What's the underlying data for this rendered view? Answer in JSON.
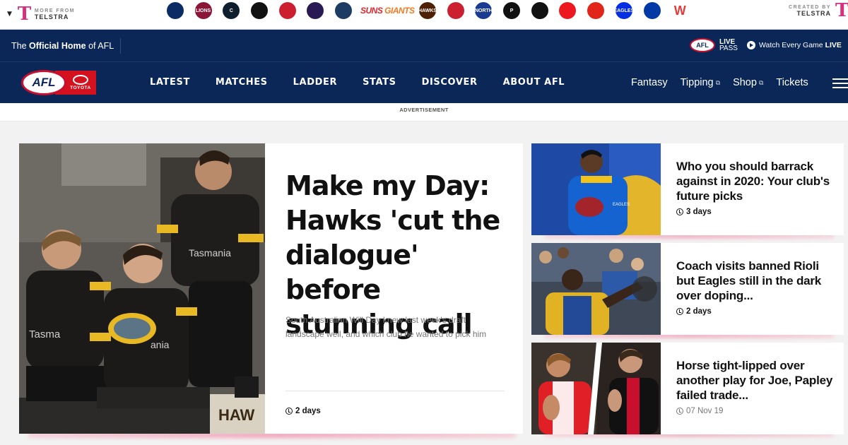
{
  "topbar": {
    "left_small": "MORE FROM",
    "left_brand": "TELSTRA",
    "right_small": "CREATED BY",
    "right_brand": "TELSTRA",
    "clubs": [
      {
        "name": "adelaide-crows",
        "color": "#0a2b64",
        "text": ""
      },
      {
        "name": "brisbane-lions",
        "color": "#8a1538",
        "text": "LIONS"
      },
      {
        "name": "carlton",
        "color": "#0e1e2d",
        "text": "C"
      },
      {
        "name": "collingwood",
        "color": "#111111",
        "text": ""
      },
      {
        "name": "essendon",
        "color": "#cc2031",
        "text": ""
      },
      {
        "name": "fremantle",
        "color": "#2a1a54",
        "text": ""
      },
      {
        "name": "geelong",
        "color": "#1c3c63",
        "text": ""
      },
      {
        "name": "gold-coast-suns",
        "color": "#e2252d",
        "text": "SUNS"
      },
      {
        "name": "gws-giants",
        "color": "#f47920",
        "text": "GIANTS"
      },
      {
        "name": "hawthorn",
        "color": "#4d2004",
        "text": "HAWKS"
      },
      {
        "name": "melbourne",
        "color": "#cc2031",
        "text": ""
      },
      {
        "name": "north-melbourne",
        "color": "#1a3b8f",
        "text": "NORTH"
      },
      {
        "name": "port-adelaide",
        "color": "#111111",
        "text": "P"
      },
      {
        "name": "richmond",
        "color": "#111111",
        "text": ""
      },
      {
        "name": "st-kilda",
        "color": "#ed171f",
        "text": ""
      },
      {
        "name": "sydney-swans",
        "color": "#e1251b",
        "text": ""
      },
      {
        "name": "west-coast-eagles",
        "color": "#062ee2",
        "text": "EAGLES"
      },
      {
        "name": "western-bulldogs",
        "color": "#0039a6",
        "text": ""
      },
      {
        "name": "aflw",
        "color": "#e63b3b",
        "text": "W"
      }
    ]
  },
  "header": {
    "official_prefix": "The ",
    "official_bold": "Official Home",
    "official_suffix": " of AFL",
    "livepass_line1": "LIVE",
    "livepass_line2": "PASS",
    "watch_prefix": "Watch Every Game ",
    "watch_bold": "LIVE",
    "logo_text": "AFL",
    "sponsor_text": "TOYOTA",
    "nav": [
      "LATEST",
      "MATCHES",
      "LADDER",
      "STATS",
      "DISCOVER",
      "ABOUT AFL"
    ],
    "subnav": [
      {
        "label": "Fantasy",
        "external": false
      },
      {
        "label": "Tipping",
        "external": true
      },
      {
        "label": "Shop",
        "external": true
      },
      {
        "label": "Tickets",
        "external": false
      }
    ]
  },
  "advert_label": "ADVERTISEMENT",
  "feature": {
    "title": "Make my Day: Hawks 'cut the dialogue' before stunning call",
    "summary": "South Australian Will Day knew last week's draft landscape well, and which club he wanted to pick him",
    "time": "2 days"
  },
  "side_articles": [
    {
      "title": "Who you should barrack against in 2020: Your club's future picks",
      "time": "3 days",
      "bold_time": true
    },
    {
      "title": "Coach visits banned Rioli but Eagles still in the dark over doping...",
      "time": "2 days",
      "bold_time": true
    },
    {
      "title": "Horse tight-lipped over another play for Joe, Papley failed trade...",
      "time": "07 Nov 19",
      "bold_time": false
    }
  ],
  "colors": {
    "navy": "#0a2758",
    "afl_red": "#c8102e",
    "telstra_pink": "#d6307f",
    "accent_pink": "#f08fab"
  }
}
